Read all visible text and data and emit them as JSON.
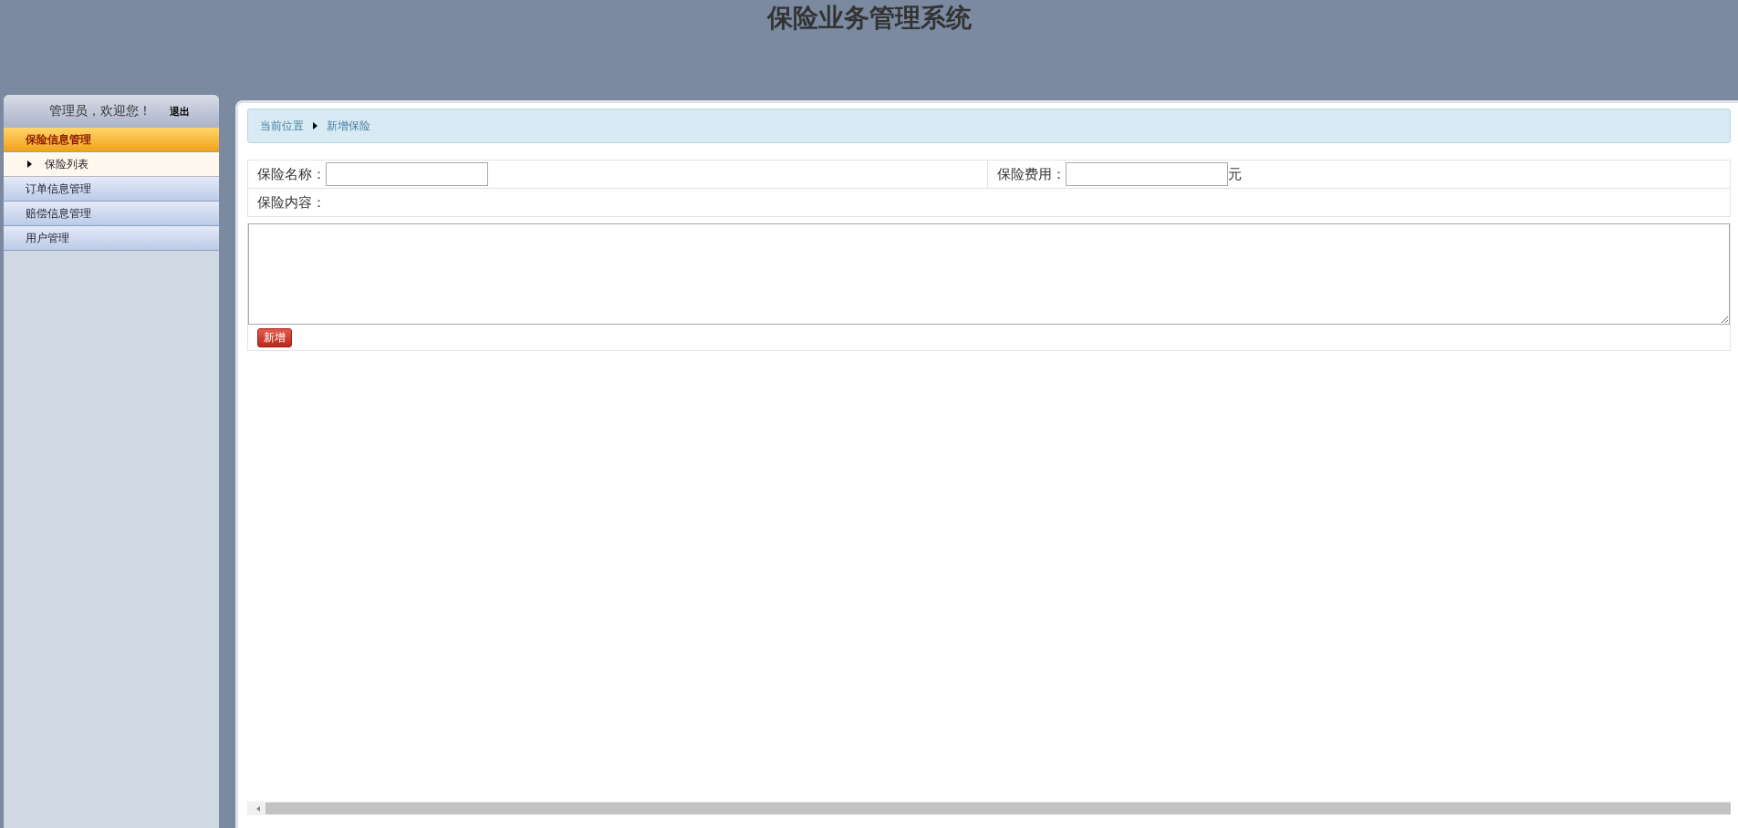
{
  "header": {
    "title": "保险业务管理系统"
  },
  "sidebar": {
    "welcome": "管理员，欢迎您！",
    "logout": "退出",
    "menu": [
      {
        "label": "保险信息管理",
        "selected": true,
        "children": [
          {
            "label": "保险列表"
          }
        ]
      },
      {
        "label": "订单信息管理",
        "selected": false
      },
      {
        "label": "赔偿信息管理",
        "selected": false
      },
      {
        "label": "用户管理",
        "selected": false
      }
    ]
  },
  "breadcrumb": [
    "当前位置",
    "新增保险"
  ],
  "form": {
    "name_label": "保险名称：",
    "price_label": "保险费用：",
    "price_unit": "元",
    "content_label": "保险内容：",
    "submit": "新增"
  }
}
